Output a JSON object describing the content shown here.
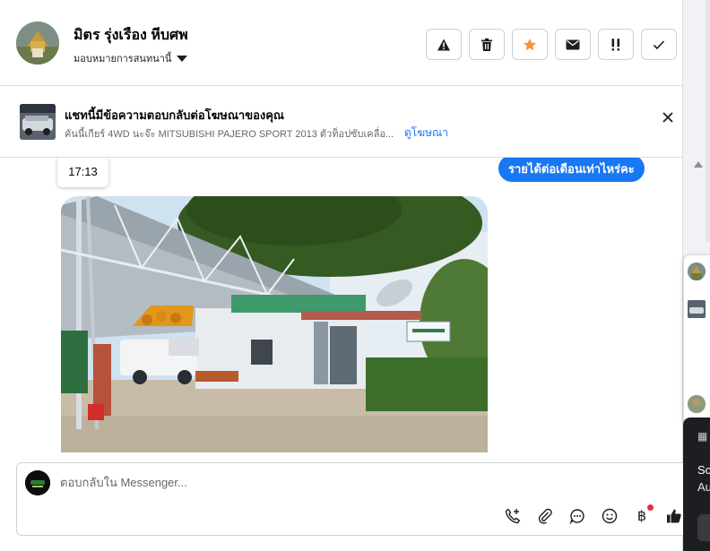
{
  "header": {
    "contact_name": "มิตร รุ่งเรือง หีบศพ",
    "assign_label": "มอบหมายการสนทนานี้",
    "actions": [
      {
        "name": "spam-button",
        "icon": "warning-icon"
      },
      {
        "name": "delete-button",
        "icon": "trash-icon"
      },
      {
        "name": "star-button",
        "icon": "star-icon"
      },
      {
        "name": "mark-unread-button",
        "icon": "envelope-icon"
      },
      {
        "name": "follow-up-button",
        "icon": "exclamation-icon"
      },
      {
        "name": "done-button",
        "icon": "check-icon"
      }
    ]
  },
  "ad_banner": {
    "title": "แชทนี้มีข้อความตอบกลับต่อโฆษณาของคุณ",
    "subtitle": "คันนี้เกียร์ 4WD นะจ๊ะ MITSUBISHI PAJERO SPORT 2013 ตัวท็อปซับเคลื่อ...",
    "link": "ดูโฆษณา"
  },
  "conversation": {
    "timestamp": "17:13",
    "outgoing_message": "รายได้ต่อเดือนเท่าไหร่คะ",
    "attachment_icon": "photo-icon"
  },
  "composer": {
    "placeholder": "ตอบกลับใน Messenger...",
    "tools": [
      {
        "name": "call-add-icon",
        "glyph": "✆"
      },
      {
        "name": "attach-icon",
        "glyph": "📎"
      },
      {
        "name": "saved-reply-icon",
        "glyph": "💬"
      },
      {
        "name": "emoji-icon",
        "glyph": "☺"
      },
      {
        "name": "payment-icon",
        "glyph": "฿"
      },
      {
        "name": "like-icon",
        "glyph": "👍"
      }
    ]
  },
  "side_card": {
    "line1": "Sc",
    "line2": "Au"
  },
  "colors": {
    "accent": "#1877f2",
    "star": "#f7923b",
    "notification": "#f02849"
  }
}
